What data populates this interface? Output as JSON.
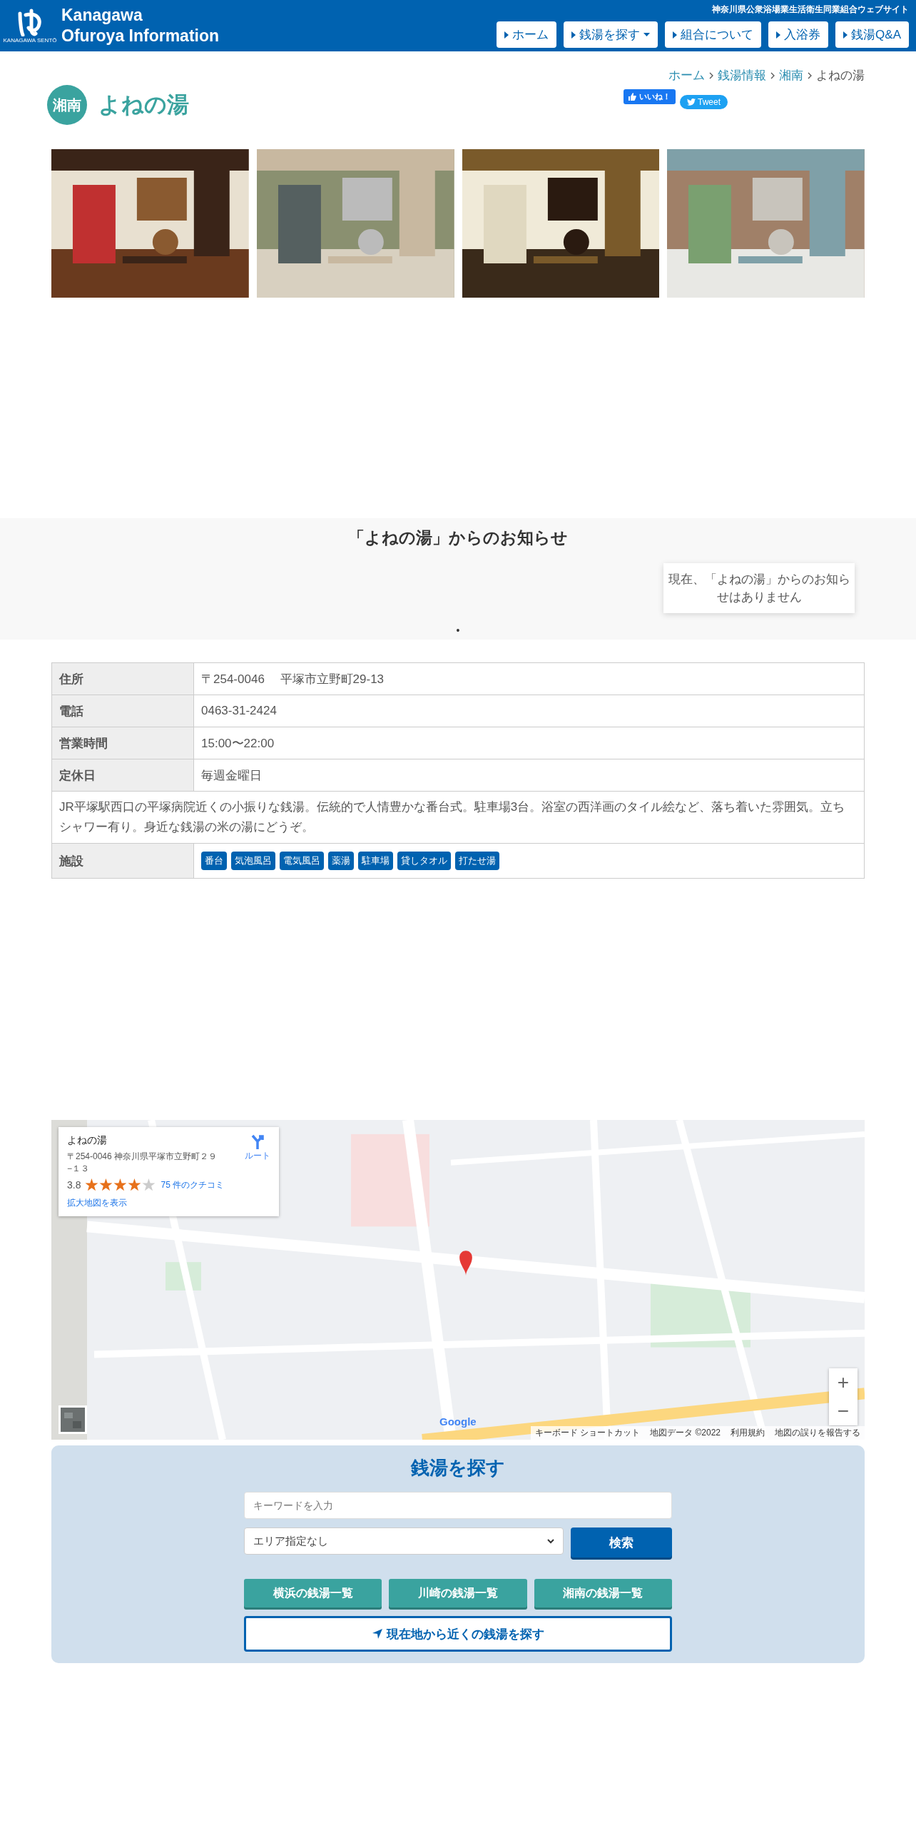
{
  "header": {
    "logo_caption": "KANAGAWA SENTŌ",
    "site_title_lines": [
      "Kanagawa",
      "Ofuroya Information"
    ],
    "tagline": "神奈川県公衆浴場業生活衛生同業組合ウェブサイト",
    "nav": [
      {
        "label": "ホーム",
        "dropdown": false
      },
      {
        "label": "銭湯を探す",
        "dropdown": true
      },
      {
        "label": "組合について",
        "dropdown": false
      },
      {
        "label": "入浴券",
        "dropdown": false
      },
      {
        "label": "銭湯Q&A",
        "dropdown": false
      }
    ]
  },
  "breadcrumb": [
    {
      "label": "ホーム",
      "link": true
    },
    {
      "label": "銭湯情報",
      "link": true
    },
    {
      "label": "湘南",
      "link": true
    },
    {
      "label": "よねの湯",
      "link": false
    }
  ],
  "title": {
    "area": "湘南",
    "name": "よねの湯"
  },
  "social": {
    "like": "いいね！",
    "tweet": "Tweet"
  },
  "notice": {
    "heading": "「よねの湯」からのお知らせ",
    "message": "現在、「よねの湯」からのお知らせはありません",
    "dot": "•"
  },
  "info": [
    {
      "label": "住所",
      "value": "〒254-0046　 平塚市立野町29-13"
    },
    {
      "label": "電話",
      "value": "0463-31-2424"
    },
    {
      "label": "営業時間",
      "value": "15:00〜22:00"
    },
    {
      "label": "定休日",
      "value": "毎週金曜日"
    }
  ],
  "description": "JR平塚駅西口の平塚病院近くの小振りな銭湯。伝統的で人情豊かな番台式。駐車場3台。浴室の西洋画のタイル絵など、落ち着いた雰囲気。立ちシャワー有り。身近な銭湯の米の湯にどうぞ。",
  "facilities": {
    "label": "施設",
    "tags": [
      "番台",
      "気泡風呂",
      "電気風呂",
      "薬湯",
      "駐車場",
      "貸しタオル",
      "打たせ湯"
    ]
  },
  "map": {
    "card": {
      "name": "よねの湯",
      "address": "〒254-0046 神奈川県平塚市立野町２９−１３",
      "rating": "3.8",
      "stars": 4,
      "reviews": "75 件のクチコミ",
      "route": "ルート",
      "larger": "拡大地図を表示"
    },
    "google": "Google",
    "attribution": [
      "キーボード ショートカット",
      "地図データ ©2022",
      "利用規約",
      "地図の誤りを報告する"
    ],
    "zoom_in": "+",
    "zoom_out": "−"
  },
  "search": {
    "heading": "銭湯を探す",
    "placeholder": "キーワードを入力",
    "area": "エリア指定なし",
    "submit": "検索",
    "lists": [
      "横浜の銭湯一覧",
      "川崎の銭湯一覧",
      "湘南の銭湯一覧"
    ],
    "nearby": "現在地から近くの銭湯を探す"
  }
}
